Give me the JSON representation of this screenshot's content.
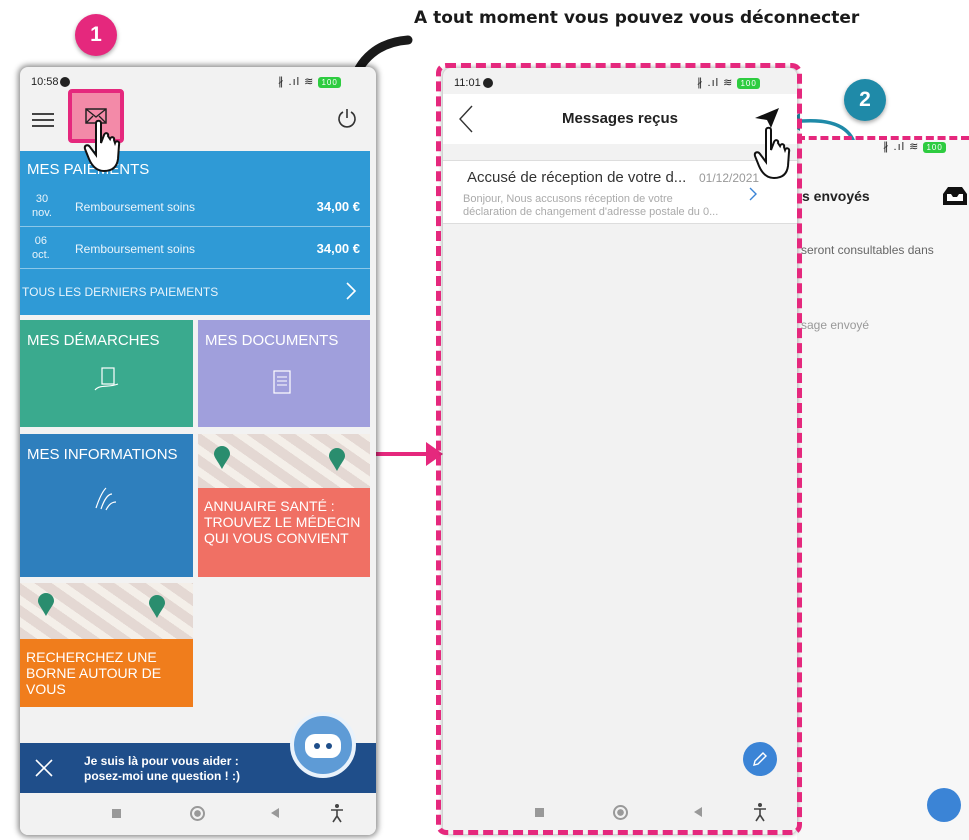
{
  "tutorial": {
    "caption": "A tout moment vous pouvez vous déconnecter",
    "step1": "1",
    "step2": "2",
    "colors": {
      "highlight": "#e5287d",
      "step2": "#1f8aa8",
      "connector": "#1f8aa8"
    }
  },
  "phone_home": {
    "status_time": "10:58",
    "battery": "100",
    "icons": [
      "menu-icon",
      "mail-icon",
      "power-icon"
    ],
    "payments": {
      "title": "MES PAIEMENTS",
      "rows": [
        {
          "day": "30",
          "month": "nov.",
          "label": "Remboursement soins",
          "amount": "34,00 €"
        },
        {
          "day": "06",
          "month": "oct.",
          "label": "Remboursement soins",
          "amount": "34,00 €"
        }
      ],
      "all_link": "TOUS LES DERNIERS PAIEMENTS"
    },
    "tiles": {
      "demarches": "MES DÉMARCHES",
      "documents": "MES DOCUMENTS",
      "informations": "MES INFORMATIONS",
      "annuaire": "ANNUAIRE SANTÉ : TROUVEZ LE MÉDECIN QUI VOUS CONVIENT",
      "borne": "RECHERCHEZ UNE BORNE AUTOUR DE VOUS"
    },
    "assistant": {
      "line1": "Je suis là pour vous aider :",
      "line2": "posez-moi une question ! :)"
    },
    "colors": {
      "payments": "#2f9ad6",
      "demarches": "#3aaa8e",
      "documents": "#a09fdc",
      "informations": "#2e7fbd",
      "annuaire": "#f07064",
      "borne": "#f07d1c"
    }
  },
  "phone_messages": {
    "status_time": "11:01",
    "battery": "100",
    "title": "Messages reçus",
    "message": {
      "subject": "Accusé de réception de votre d...",
      "date": "01/12/2021",
      "preview_line1": "Bonjour, Nous accusons réception de votre",
      "preview_line2": "déclaration de changement d'adresse postale du 0..."
    }
  },
  "phone_sent": {
    "title_partial": "s envoyés",
    "text1": "seront consultables dans",
    "text2": "sage envoyé",
    "battery": "100"
  }
}
